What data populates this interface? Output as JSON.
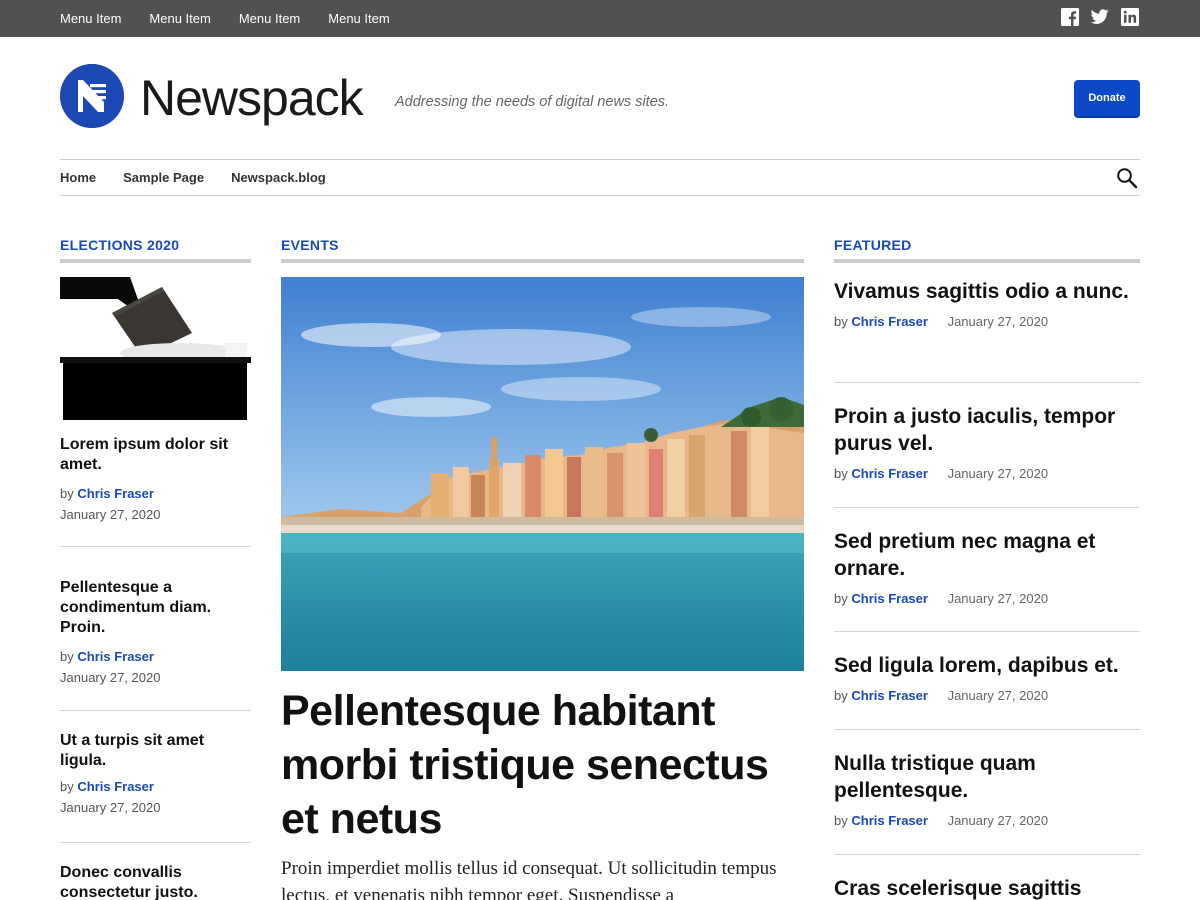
{
  "top_menu": [
    "Menu Item",
    "Menu Item",
    "Menu Item",
    "Menu Item"
  ],
  "social": [
    "facebook-icon",
    "twitter-icon",
    "linkedin-icon"
  ],
  "site": {
    "title": "Newspack",
    "tagline": "Addressing the needs of digital news sites.",
    "donate_label": "Donate",
    "brand_color": "#1b4ab5"
  },
  "nav": [
    "Home",
    "Sample Page",
    "Newspack.blog"
  ],
  "sections": {
    "left": "ELECTIONS 2020",
    "center": "EVENTS",
    "right": "FEATURED"
  },
  "left_articles": [
    {
      "title": "Lorem ipsum dolor sit amet.",
      "by": "by",
      "author": "Chris Fraser",
      "date": "January 27, 2020"
    },
    {
      "title": "Pellentesque a condimentum diam. Proin.",
      "by": "by",
      "author": "Chris Fraser",
      "date": "January 27, 2020"
    },
    {
      "title": "Ut a turpis sit amet ligula.",
      "by": "by",
      "author": "Chris Fraser",
      "date": "January 27, 2020"
    },
    {
      "title": "Donec convallis consectetur justo.",
      "by": "",
      "author": "",
      "date": ""
    }
  ],
  "hero": {
    "title": "Pellentesque habitant morbi tristique senectus et netus",
    "excerpt": "Proin imperdiet mollis tellus id consequat. Ut sollicitudin tempus lectus, et venenatis nibh tempor eget. Suspendisse a"
  },
  "featured": [
    {
      "title": "Vivamus sagittis odio a nunc.",
      "by": "by",
      "author": "Chris Fraser",
      "date": "January 27, 2020"
    },
    {
      "title": "Proin a justo iaculis, tempor purus vel.",
      "by": "by",
      "author": "Chris Fraser",
      "date": "January 27, 2020"
    },
    {
      "title": "Sed pretium nec magna et ornare.",
      "by": "by",
      "author": "Chris Fraser",
      "date": "January 27, 2020"
    },
    {
      "title": "Sed ligula lorem, dapibus et.",
      "by": "by",
      "author": "Chris Fraser",
      "date": "January 27, 2020"
    },
    {
      "title": "Nulla tristique quam pellentesque.",
      "by": "by",
      "author": "Chris Fraser",
      "date": "January 27, 2020"
    },
    {
      "title": "Cras scelerisque sagittis",
      "by": "",
      "author": "",
      "date": ""
    }
  ]
}
